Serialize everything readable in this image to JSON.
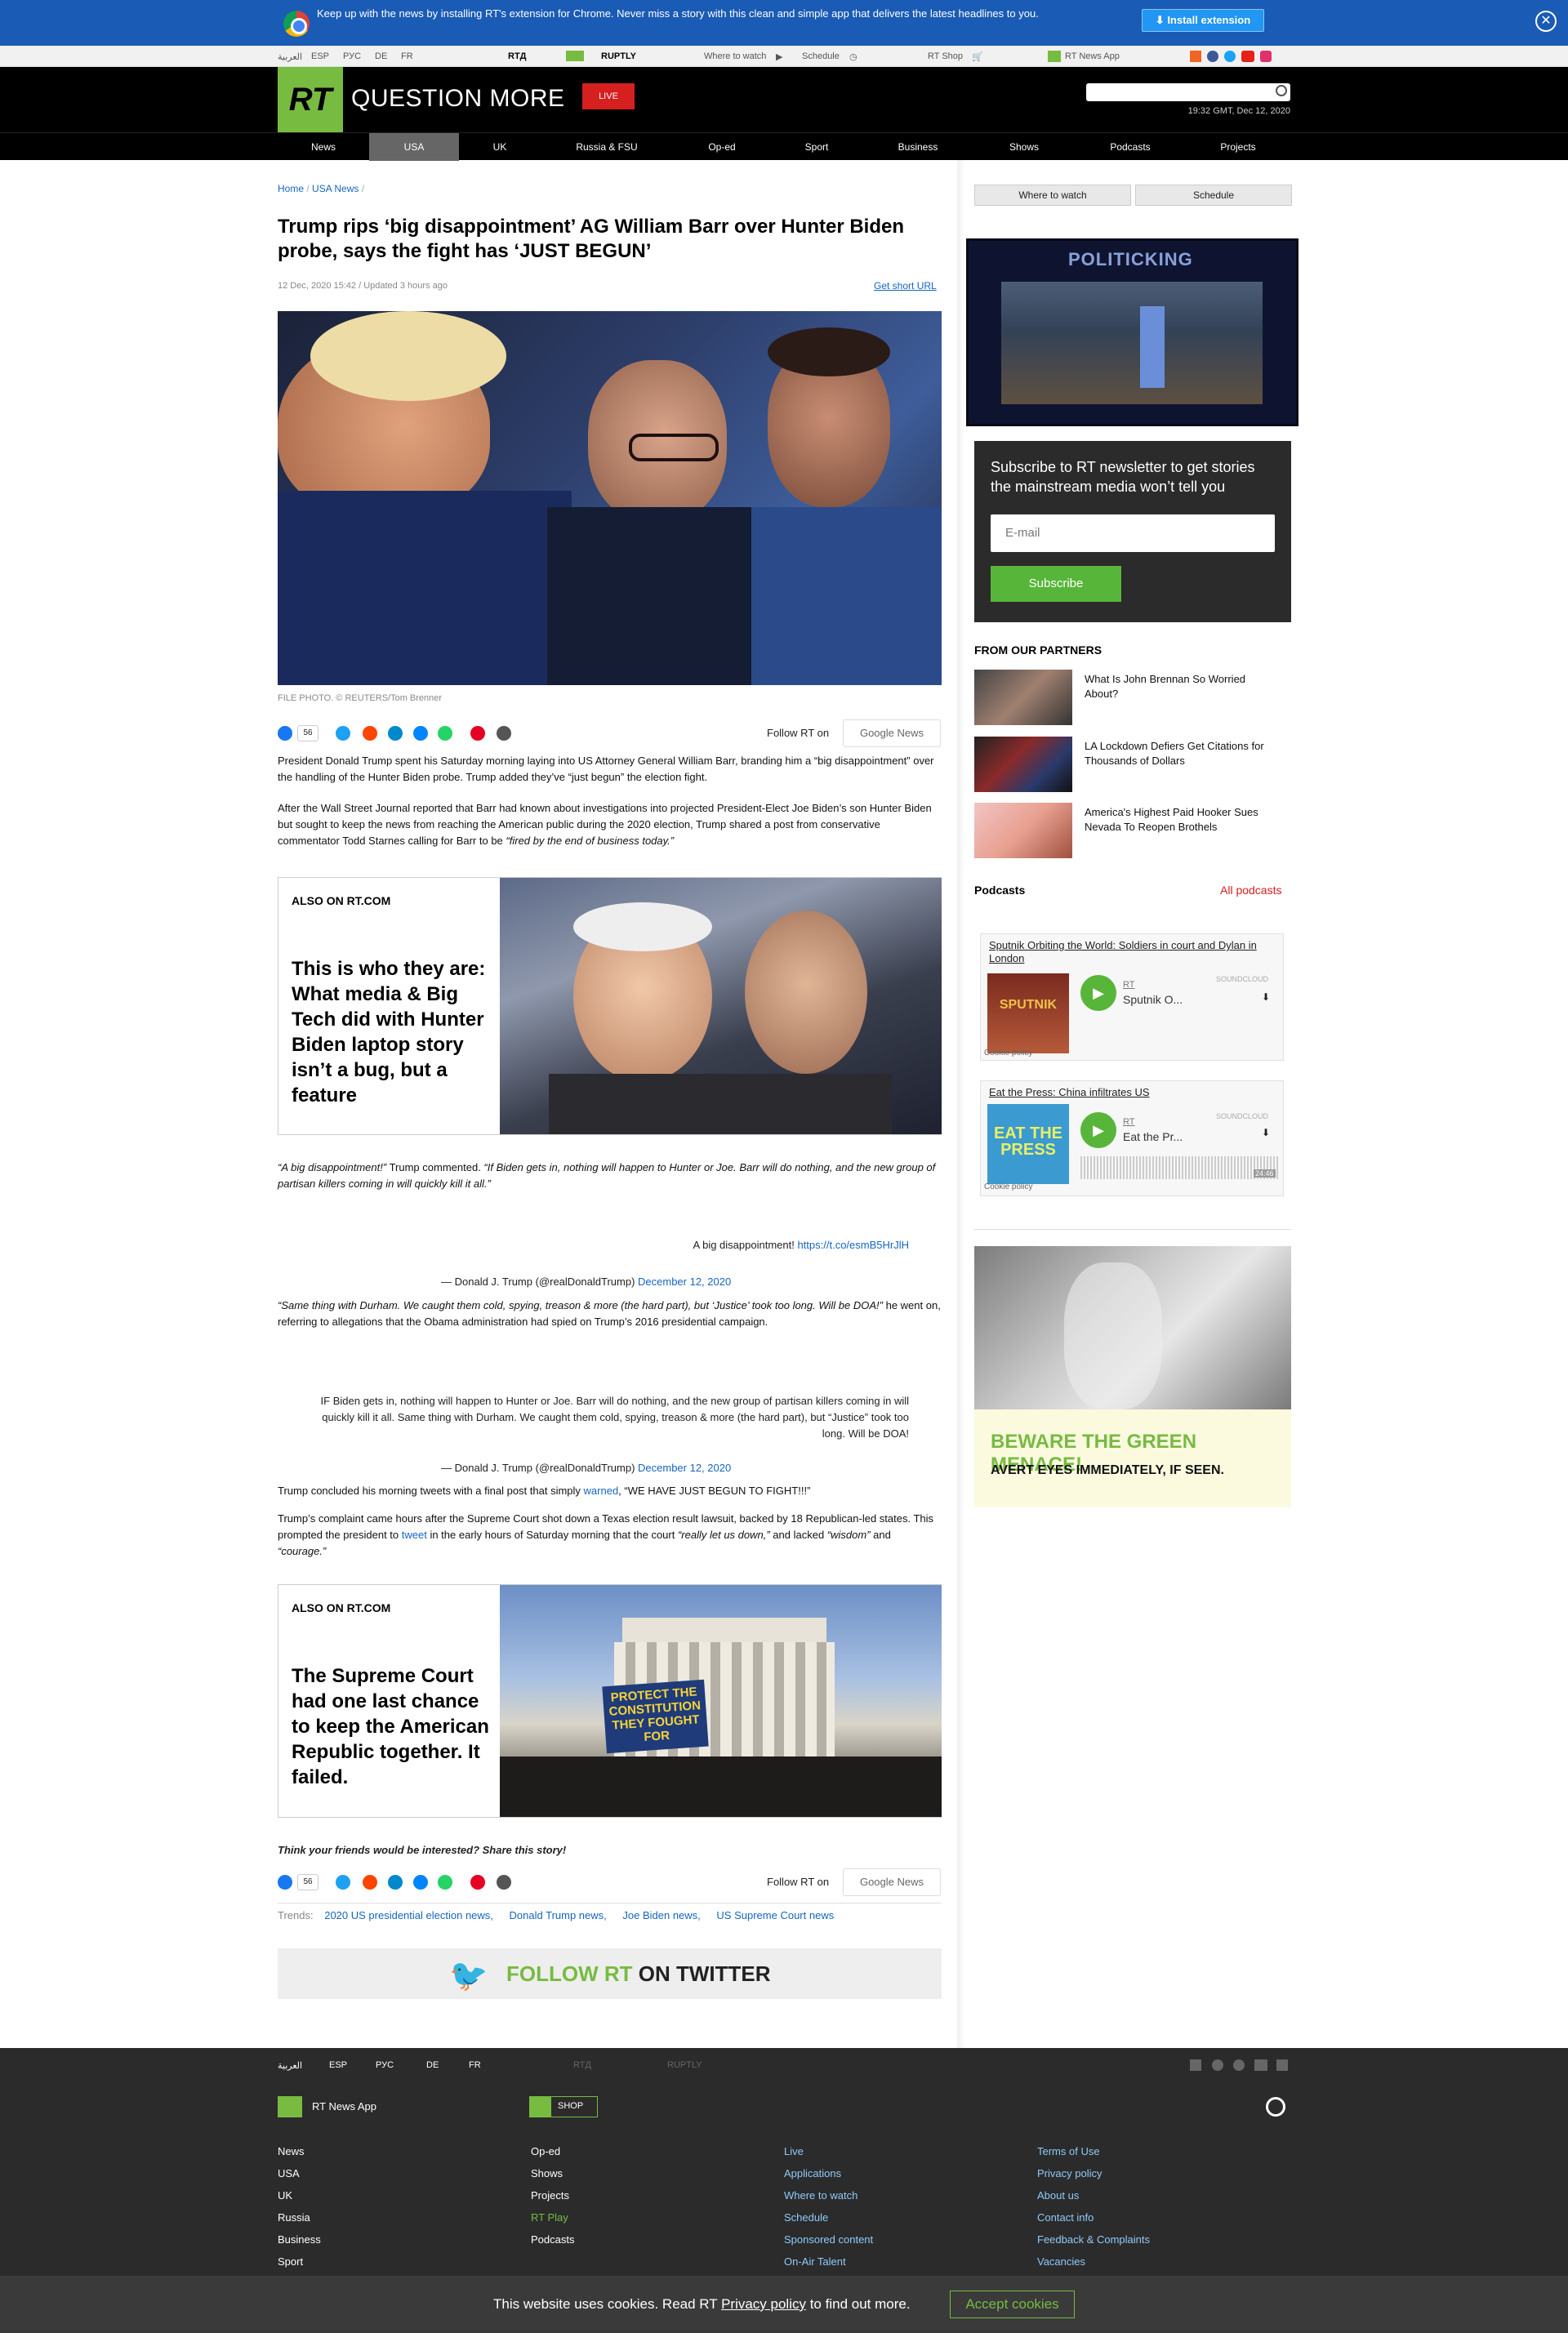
{
  "banner": {
    "message": "Keep up with the news by installing RT's extension for Chrome. Never miss a story with this clean and simple app that delivers the latest headlines to you.",
    "button": "Install extension"
  },
  "topbar": {
    "langs": [
      "العربية",
      "ESP",
      "РУС",
      "DE",
      "FR"
    ],
    "rtd": "RTД",
    "ruptly": "RUPTLY",
    "where": "Where to watch",
    "schedule": "Schedule",
    "shop": "RT Shop",
    "app": "RT News App"
  },
  "header": {
    "logo": "RT",
    "tagline": "QUESTION MORE",
    "live": "LIVE",
    "clock": "19:32 GMT, Dec 12, 2020"
  },
  "nav": [
    "News",
    "USA",
    "UK",
    "Russia & FSU",
    "Op-ed",
    "Sport",
    "Business",
    "Shows",
    "Podcasts",
    "Projects"
  ],
  "breadcrumb": [
    "Home",
    "USA News"
  ],
  "article": {
    "title": "Trump rips ‘big disappointment’ AG William Barr over Hunter Biden probe, says the fight has ‘JUST BEGUN’",
    "date": "12 Dec, 2020 15:42 / Updated 3 hours ago",
    "short_url": "Get short URL",
    "caption": "FILE PHOTO. © REUTERS/Tom Brenner",
    "share_count": "56",
    "follow": "Follow RT on",
    "gnews": "Google News",
    "p1": "President Donald Trump spent his Saturday morning laying into US Attorney General William Barr, branding him a “big disappointment” over the handling of the Hunter Biden probe. Trump added they’ve “just begun” the election fight.",
    "p2a": "After the Wall Street Journal reported that Barr had known about investigations into projected President-Elect Joe Biden’s son Hunter Biden but sought to keep the news from reaching the American public during the 2020 election, Trump shared a post from conservative commentator Todd Starnes calling for Barr to be ",
    "p2b": "“fired by the end of business today.”",
    "also_label": "ALSO ON RT.COM",
    "also1": "This is who they are: What media & Big Tech did with Hunter Biden laptop story isn’t a bug, but a feature",
    "p3a": "“A big disappointment!”",
    "p3b": " Trump commented. ",
    "p3c": "“If Biden gets in, nothing will happen to Hunter or Joe. Barr will do nothing, and the new group of partisan killers coming in will quickly kill it all.”",
    "tw1_text": "A big disappointment! ",
    "tw1_link": "https://t.co/esmB5HrJlH",
    "tw_author": "— Donald J. Trump (@realDonaldTrump) ",
    "tw_date": "December 12, 2020",
    "p4a": "“Same thing with Durham. We caught them cold, spying, treason & more (the hard part), but ‘Justice’ took too long. Will be DOA!”",
    "p4b": " he went on, referring to allegations that the Obama administration had spied on Trump’s 2016 presidential campaign.",
    "tw2": "IF Biden gets in, nothing will happen to Hunter or Joe. Barr will do nothing, and the new group of partisan killers coming in will quickly kill it all. Same thing with Durham. We caught them cold, spying, treason & more (the hard part), but “Justice” took too long. Will be DOA!",
    "p5a": "Trump concluded his morning tweets with a final post that simply ",
    "p5link": "warned",
    "p5b": ", “WE HAVE JUST BEGUN TO FIGHT!!!”",
    "p6a": "Trump’s complaint came hours after the Supreme Court shot down a Texas election result lawsuit, backed by 18 Republican-led states. This prompted the president to ",
    "p6link": "tweet",
    "p6b": " in the early hours of Saturday morning that the court ",
    "p6c": "“really let us down,”",
    "p6d": " and lacked ",
    "p6e": "“wisdom”",
    "p6f": " and ",
    "p6g": "“courage.”",
    "also2": "The Supreme Court had one last chance to keep the American Republic together. It failed.",
    "sign_protect": "PROTECT THE CONSTITUTION THEY FOUGHT FOR",
    "share_prompt": "Think your friends would be interested? Share this story!",
    "trends_label": "Trends:",
    "trends": [
      "2020 US presidential election news,",
      "Donald Trump news,",
      "Joe Biden news,",
      "US Supreme Court news"
    ],
    "twitter_follow_a": "FOLLOW RT",
    "twitter_follow_b": " ON TWITTER"
  },
  "sidebar": {
    "where": "Where to watch",
    "schedule": "Schedule",
    "politicking": "POLITICKING",
    "newsletter": "Subscribe to RT newsletter to get stories the mainstream media won’t tell you",
    "email_placeholder": "E-mail",
    "subscribe": "Subscribe",
    "partners_title": "FROM OUR PARTNERS",
    "partners": [
      "What Is John Brennan So Worried About?",
      "LA Lockdown Defiers Get Citations for Thousands of Dollars",
      "America's Highest Paid Hooker Sues Nevada To Reopen Brothels"
    ],
    "podcasts_title": "Podcasts",
    "all_podcasts": "All podcasts",
    "pod1_title": "Sputnik Orbiting the World: Soldiers in court and Dylan in London",
    "pod1_short": "Sputnik O...",
    "pod1_cover": "SPUTNIK",
    "pod2_title": "Eat the Press: China infiltrates US",
    "pod2_short": "Eat the Pr...",
    "pod2_cover": "EAT THE PRESS",
    "pod2_time": "24:46",
    "rt": "RT",
    "soundcloud": "SOUNDCLOUD",
    "cookie_policy": "Cookie policy",
    "ad_a": "BEWARE THE GREEN MENACE!",
    "ad_b": "AVERT EYES IMMEDIATELY, IF SEEN."
  },
  "footer": {
    "langs": [
      "العربية",
      "ESP",
      "РУС",
      "DE",
      "FR"
    ],
    "rtd": "RTД",
    "ruptly": "RUPTLY",
    "app": "RT News App",
    "shop": "SHOP",
    "col1": [
      "News",
      "USA",
      "UK",
      "Russia",
      "Business",
      "Sport"
    ],
    "col2": [
      "Op-ed",
      "Shows",
      "Projects",
      "RT Play",
      "Podcasts"
    ],
    "col3": [
      "Live",
      "Applications",
      "Where to watch",
      "Schedule",
      "Sponsored content",
      "On-Air Talent"
    ],
    "col4": [
      "Terms of Use",
      "Privacy policy",
      "About us",
      "Contact info",
      "Feedback & Complaints",
      "Vacancies"
    ]
  },
  "cookie": {
    "text_a": "This website uses cookies. Read RT ",
    "link": "Privacy policy",
    "text_b": " to find out more.",
    "accept": "Accept cookies"
  },
  "colors": {
    "rt_green": "#77bb41",
    "live_red": "#d61f1f",
    "banner_blue": "#1a5bb5",
    "link_blue": "#1565c0"
  }
}
